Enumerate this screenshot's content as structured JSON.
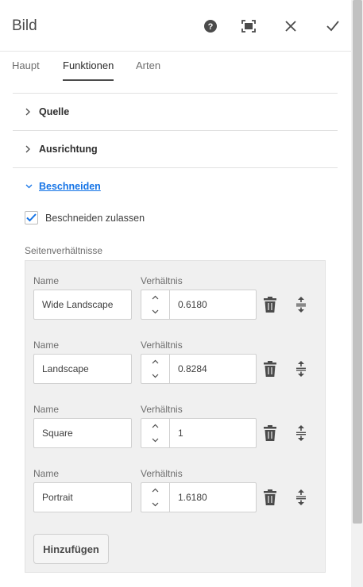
{
  "header": {
    "title": "Bild",
    "icons": [
      "help-icon",
      "fullscreen-icon",
      "close-icon",
      "done-checkmark-icon"
    ]
  },
  "tabs": [
    {
      "label": "Haupt",
      "active": false
    },
    {
      "label": "Funktionen",
      "active": true
    },
    {
      "label": "Arten",
      "active": false
    }
  ],
  "accordion": [
    {
      "label": "Quelle",
      "open": false
    },
    {
      "label": "Ausrichtung",
      "open": false
    },
    {
      "label": "Beschneiden",
      "open": true
    }
  ],
  "crop": {
    "allow_label": "Beschneiden zulassen",
    "allow_checked": true,
    "aspect_label": "Seitenverhältnisse",
    "name_label": "Name",
    "ratio_label": "Verhältnis",
    "rows": [
      {
        "name": "Wide Landscape",
        "ratio": "0.6180"
      },
      {
        "name": "Landscape",
        "ratio": "0.8284"
      },
      {
        "name": "Square",
        "ratio": "1"
      },
      {
        "name": "Portrait",
        "ratio": "1.6180"
      }
    ],
    "add_label": "Hinzufügen"
  },
  "colors": {
    "accent": "#1473e6",
    "text": "#2c2c2c",
    "panel_bg": "#f0f0f0"
  }
}
